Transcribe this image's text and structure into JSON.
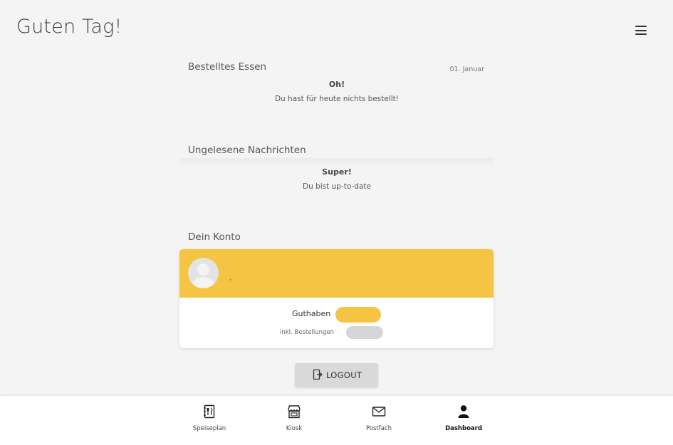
{
  "header": {
    "greeting": "Guten Tag!"
  },
  "ordered_food": {
    "title": "Bestelltes Essen",
    "date": "01. Januar",
    "empty_title": "Oh!",
    "empty_text": "Du hast für heute nichts bestellt!"
  },
  "messages": {
    "title": "Ungelesene Nachrichten",
    "empty_title": "Super!",
    "empty_text": "Du bist up-to-date"
  },
  "account": {
    "title": "Dein Konto",
    "user_name": ",",
    "balance_label": "Guthaben",
    "balance_value": "",
    "incl_label": "inkl. Bestellungen",
    "incl_value": "",
    "accent_color": "#f5c443"
  },
  "logout": {
    "label": "LOGOUT"
  },
  "bottom_nav": {
    "items": [
      {
        "label": "Speiseplan",
        "icon": "menu-book-icon"
      },
      {
        "label": "Kiosk",
        "icon": "kiosk-shop-icon"
      },
      {
        "label": "Postfach",
        "icon": "envelope-icon"
      },
      {
        "label": "Dashboard",
        "icon": "user-icon",
        "active": true
      }
    ]
  }
}
